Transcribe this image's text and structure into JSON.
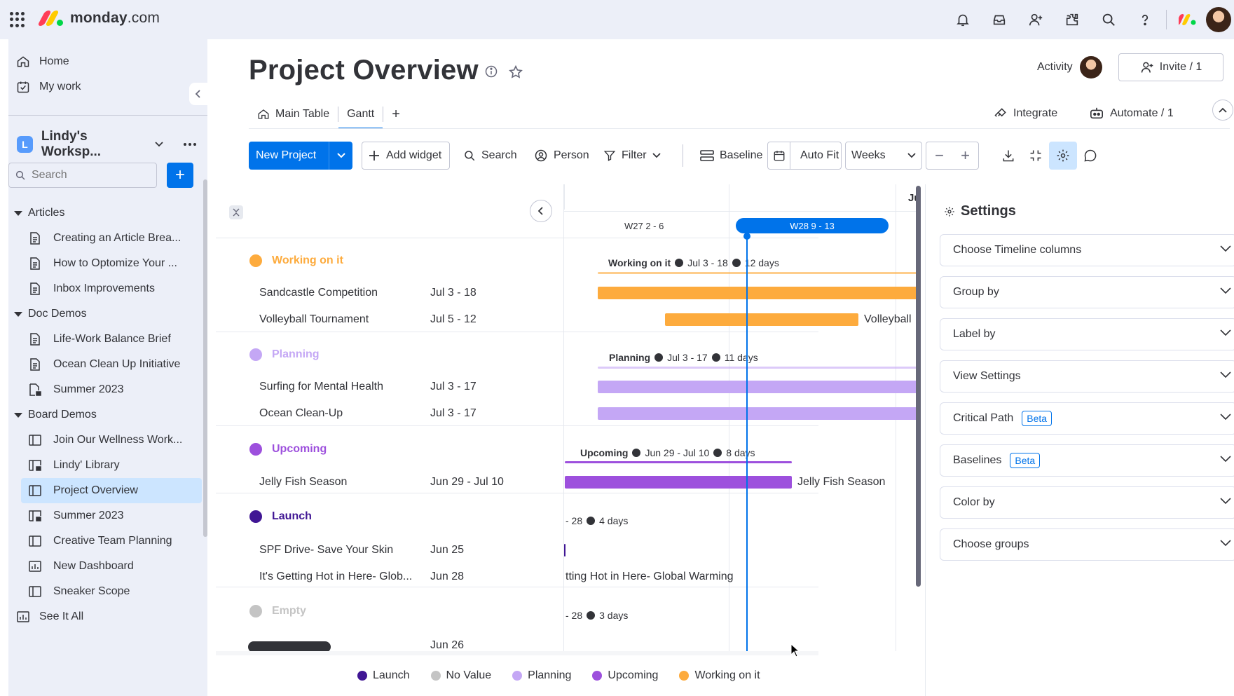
{
  "app": {
    "brand_bold": "monday",
    "brand_light": ".com"
  },
  "colors": {
    "brand_red": "#ff3d57",
    "brand_yellow": "#ffcb00",
    "brand_green": "#00d647",
    "accent": "#0073ea",
    "working_on_it": "#fdab3d",
    "planning": "#c4a7f5",
    "upcoming": "#9d50dd",
    "launch": "#401694",
    "empty": "#c4c4c4"
  },
  "topbar": {
    "icons": [
      "bell-icon",
      "inbox-icon",
      "invite-members-icon",
      "apps-marketplace-icon",
      "search-icon",
      "help-icon"
    ]
  },
  "sidebar": {
    "home": "Home",
    "my_work": "My work",
    "workspace": {
      "badge": "L",
      "name": "Lindy's Worksp..."
    },
    "search_placeholder": "Search",
    "groups": [
      {
        "label": "Articles",
        "items": [
          "Creating an Article Brea...",
          "How to Optomize Your ...",
          "Inbox Improvements"
        ]
      },
      {
        "label": "Doc Demos",
        "items": [
          "Life-Work Balance Brief",
          "Ocean Clean Up Initiative",
          "Summer 2023"
        ]
      },
      {
        "label": "Board Demos",
        "items": [
          "Join Our Wellness Work...",
          "Lindy' Library",
          "Project Overview",
          "Summer 2023",
          "Creative Team Planning",
          "New Dashboard",
          "Sneaker Scope"
        ]
      }
    ],
    "see_all": "See It All"
  },
  "board": {
    "title": "Project Overview",
    "activity": "Activity",
    "invite": "Invite / 1",
    "tabs": [
      {
        "label": "Main Table"
      },
      {
        "label": "Gantt"
      }
    ],
    "tab_add": "+",
    "integrate": "Integrate",
    "automate": "Automate / 1"
  },
  "toolbar": {
    "new_project": "New Project",
    "add_widget": "Add widget",
    "search": "Search",
    "person": "Person",
    "filter": "Filter",
    "baseline": "Baseline",
    "auto_fit": "Auto Fit",
    "weeks": "Weeks",
    "zoom_out": "−",
    "zoom_in": "+"
  },
  "timeline": {
    "month": "Ju",
    "weeks": [
      {
        "label": "W27 2 - 6",
        "current": false
      },
      {
        "label": "W28 9 - 13",
        "current": true
      }
    ]
  },
  "groups": [
    {
      "name": "Working on it",
      "summary": {
        "name": "Working on it",
        "range": "Jul 3 - 18",
        "duration": "12 days"
      },
      "items": [
        {
          "name": "Sandcastle Competition",
          "date": "Jul 3 - 18",
          "bar_label": ""
        },
        {
          "name": "Volleyball Tournament",
          "date": "Jul 5 - 12",
          "bar_label": "Volleyball"
        }
      ]
    },
    {
      "name": "Planning",
      "summary": {
        "name": "Planning",
        "range": "Jul 3 - 17",
        "duration": "11 days"
      },
      "items": [
        {
          "name": "Surfing for Mental Health",
          "date": "Jul 3 - 17",
          "bar_label": ""
        },
        {
          "name": "Ocean Clean-Up",
          "date": "Jul 3 - 17",
          "bar_label": ""
        }
      ]
    },
    {
      "name": "Upcoming",
      "summary": {
        "name": "Upcoming",
        "range": "Jun 29 - Jul 10",
        "duration": "8 days"
      },
      "items": [
        {
          "name": "Jelly Fish Season",
          "date": "Jun 29 - Jul 10",
          "bar_label": "Jelly Fish Season"
        }
      ]
    },
    {
      "name": "Launch",
      "summary": {
        "name": "",
        "range": "- 28",
        "duration": "4 days"
      },
      "items": [
        {
          "name": "SPF Drive- Save Your Skin",
          "date": "Jun 25",
          "bar_label": ""
        },
        {
          "name": "It's Getting Hot in Here- Glob...",
          "date": "Jun 28",
          "bar_label": "tting Hot in Here- Global Warming"
        }
      ]
    },
    {
      "name": "Empty",
      "summary": {
        "name": "",
        "range": "- 28",
        "duration": "3 days"
      },
      "items": [
        {
          "name": "",
          "date": "Jun 26",
          "bar_label": ""
        }
      ]
    }
  ],
  "settings": {
    "title": "Settings",
    "beta": "Beta",
    "rows": [
      "Choose Timeline columns",
      "Group by",
      "Label by",
      "View Settings",
      "Critical Path",
      "Baselines",
      "Color by",
      "Choose groups"
    ]
  },
  "legend": [
    "Launch",
    "No Value",
    "Planning",
    "Upcoming",
    "Working on it"
  ]
}
